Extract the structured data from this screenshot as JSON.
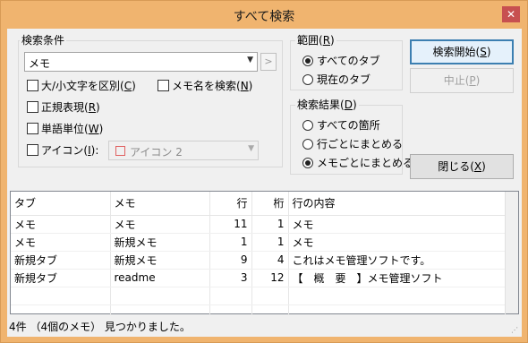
{
  "window": {
    "title": "すべて検索",
    "close_glyph": "✕"
  },
  "conditions": {
    "group_label": "検索条件",
    "search_value": "メモ",
    "history_glyph": ">",
    "options": [
      {
        "text": "大/小文字を区別(",
        "key": "C",
        "tail": ")",
        "checked": false
      },
      {
        "text": "メモ名を検索(",
        "key": "N",
        "tail": ")",
        "checked": false
      },
      {
        "text": "正規表現(",
        "key": "R",
        "tail": ")",
        "checked": false
      },
      {
        "text": "単語単位(",
        "key": "W",
        "tail": ")",
        "checked": false
      },
      {
        "text": "アイコン(",
        "key": "I",
        "tail": "):",
        "checked": false
      }
    ],
    "icon_combo_value": "アイコン 2"
  },
  "scope": {
    "group_label_text": "範囲(",
    "group_label_key": "R",
    "group_label_tail": ")",
    "options": [
      {
        "label": "すべてのタブ",
        "selected": true
      },
      {
        "label": "現在のタブ",
        "selected": false
      }
    ]
  },
  "results_mode": {
    "group_label_text": "検索結果(",
    "group_label_key": "D",
    "group_label_tail": ")",
    "options": [
      {
        "label": "すべての箇所",
        "selected": false
      },
      {
        "label": "行ごとにまとめる",
        "selected": false
      },
      {
        "label": "メモごとにまとめる",
        "selected": true
      }
    ]
  },
  "buttons": {
    "start_text": "検索開始(",
    "start_key": "S",
    "start_tail": ")",
    "stop_text": "中止(",
    "stop_key": "P",
    "stop_tail": ")",
    "close_text": "閉じる(",
    "close_key": "X",
    "close_tail": ")"
  },
  "results_table": {
    "columns": [
      "タブ",
      "メモ",
      "行",
      "桁",
      "行の内容"
    ],
    "rows": [
      [
        "メモ",
        "メモ",
        "11",
        "1",
        "メモ"
      ],
      [
        "メモ",
        "新規メモ",
        "1",
        "1",
        "メモ"
      ],
      [
        "新規タブ",
        "新規メモ",
        "9",
        "4",
        "これはメモ管理ソフトです。"
      ],
      [
        "新規タブ",
        "readme",
        "3",
        "12",
        "【　概　要　】メモ管理ソフト"
      ]
    ]
  },
  "status": {
    "text": "4件 （4個のメモ） 見つかりました。"
  },
  "colors": {
    "titlebar": "#f0b46f",
    "close": "#c75050",
    "default_button": "#3c7fb1"
  }
}
